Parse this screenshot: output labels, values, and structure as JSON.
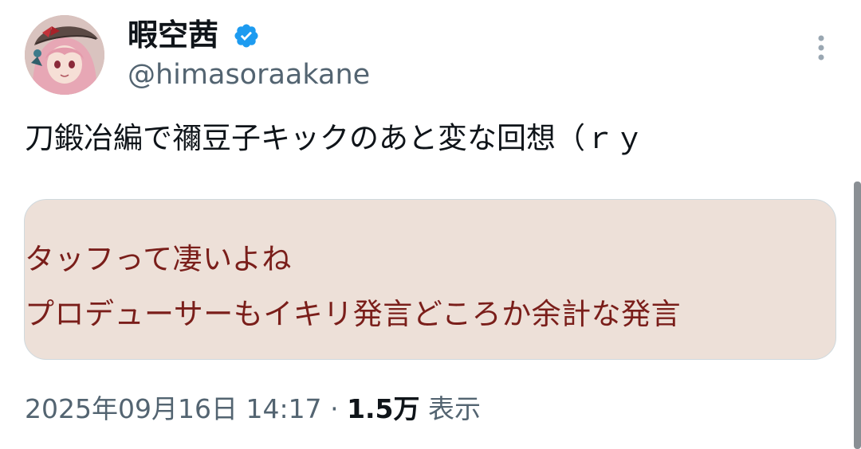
{
  "author": {
    "display_name": "暇空茜",
    "handle": "@himasoraakane",
    "verified": true,
    "avatar_icon": "anime-girl-avatar",
    "verified_icon": "verified-badge-icon"
  },
  "actions": {
    "more_icon": "more-vertical-icon"
  },
  "tweet": {
    "text": "刀鍛冶編で禰豆子キックのあと変な回想（ｒｙ"
  },
  "media": {
    "subtitle_line_1": "タッフって凄いよね",
    "subtitle_line_2": "プロデューサーもイキリ発言どころか余計な発言"
  },
  "meta": {
    "timestamp": "2025年09月16日 14:17",
    "separator": "·",
    "views_count": "1.5万",
    "views_label": "表示"
  },
  "colors": {
    "text_primary": "#0f1419",
    "text_secondary": "#536471",
    "verified_blue": "#1d9bf0",
    "card_background": "#ede0d8",
    "subtitle_text": "#7a1e1a"
  }
}
